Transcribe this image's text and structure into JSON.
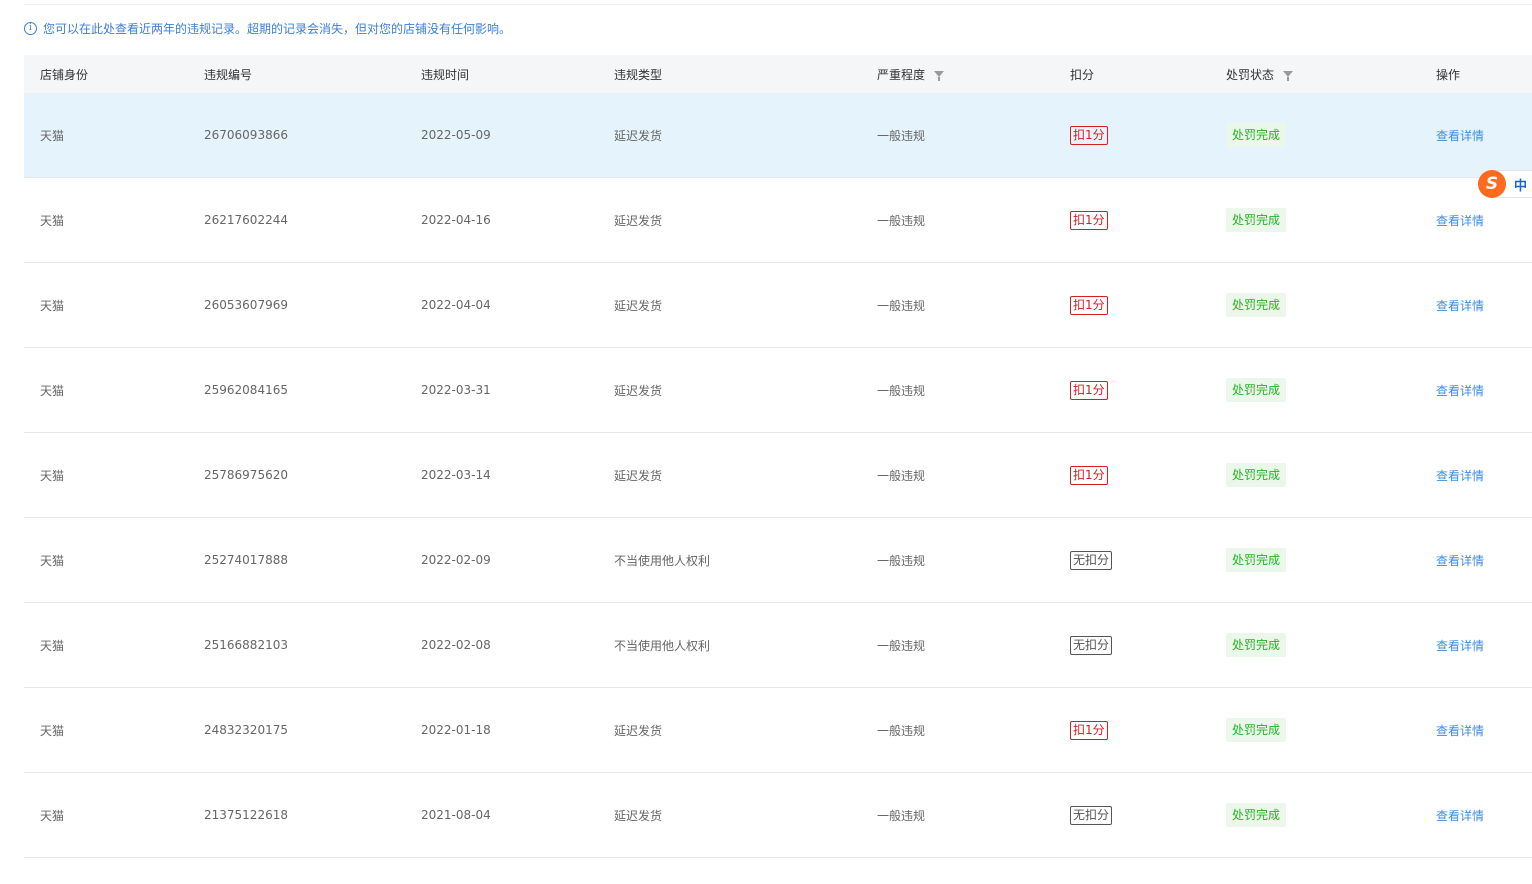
{
  "notice": {
    "icon": "info-icon",
    "text": "您可以在此处查看近两年的违规记录。超期的记录会消失，但对您的店铺没有任何影响。"
  },
  "table": {
    "headers": {
      "shop": "店铺身份",
      "id": "违规编号",
      "time": "违规时间",
      "type": "违规类型",
      "severity": "严重程度",
      "points": "扣分",
      "status": "处罚状态",
      "action": "操作"
    },
    "rows": [
      {
        "shop": "天猫",
        "id": "26706093866",
        "time": "2022-05-09",
        "type": "延迟发货",
        "severity": "一般违规",
        "points": "扣1分",
        "status": "处罚完成",
        "action": "查看详情"
      },
      {
        "shop": "天猫",
        "id": "26217602244",
        "time": "2022-04-16",
        "type": "延迟发货",
        "severity": "一般违规",
        "points": "扣1分",
        "status": "处罚完成",
        "action": "查看详情"
      },
      {
        "shop": "天猫",
        "id": "26053607969",
        "time": "2022-04-04",
        "type": "延迟发货",
        "severity": "一般违规",
        "points": "扣1分",
        "status": "处罚完成",
        "action": "查看详情"
      },
      {
        "shop": "天猫",
        "id": "25962084165",
        "time": "2022-03-31",
        "type": "延迟发货",
        "severity": "一般违规",
        "points": "扣1分",
        "status": "处罚完成",
        "action": "查看详情"
      },
      {
        "shop": "天猫",
        "id": "25786975620",
        "time": "2022-03-14",
        "type": "延迟发货",
        "severity": "一般违规",
        "points": "扣1分",
        "status": "处罚完成",
        "action": "查看详情"
      },
      {
        "shop": "天猫",
        "id": "25274017888",
        "time": "2022-02-09",
        "type": "不当使用他人权利",
        "severity": "一般违规",
        "points": "无扣分",
        "status": "处罚完成",
        "action": "查看详情"
      },
      {
        "shop": "天猫",
        "id": "25166882103",
        "time": "2022-02-08",
        "type": "不当使用他人权利",
        "severity": "一般违规",
        "points": "无扣分",
        "status": "处罚完成",
        "action": "查看详情"
      },
      {
        "shop": "天猫",
        "id": "24832320175",
        "time": "2022-01-18",
        "type": "延迟发货",
        "severity": "一般违规",
        "points": "扣1分",
        "status": "处罚完成",
        "action": "查看详情"
      },
      {
        "shop": "天猫",
        "id": "21375122618",
        "time": "2021-08-04",
        "type": "延迟发货",
        "severity": "一般违规",
        "points": "无扣分",
        "status": "处罚完成",
        "action": "查看详情"
      }
    ]
  },
  "ime": {
    "logo": "S",
    "mode": "中"
  }
}
